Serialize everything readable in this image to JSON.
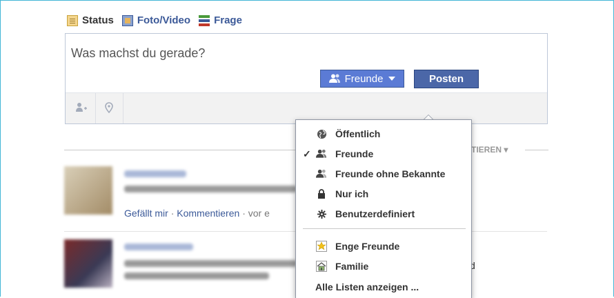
{
  "composer": {
    "tabs": [
      {
        "label": "Status"
      },
      {
        "label": "Foto/Video"
      },
      {
        "label": "Frage"
      }
    ],
    "placeholder": "Was machst du gerade?",
    "audience_label": "Freunde",
    "post_label": "Posten",
    "tag_icon": "tag-friends-icon",
    "location_icon": "location-pin-icon"
  },
  "feed": {
    "sort_label": "TIEREN",
    "story1": {
      "like_label": "Gefällt mir",
      "comment_label": "Kommentieren",
      "time_prefix": "· vor e"
    },
    "story2": {
      "trailing_char": "d"
    }
  },
  "audience_menu": {
    "items": [
      {
        "label": "Öffentlich",
        "icon": "globe-icon",
        "checked": false
      },
      {
        "label": "Freunde",
        "icon": "friends-icon",
        "checked": true
      },
      {
        "label": "Freunde ohne Bekannte",
        "icon": "friends-except-icon",
        "checked": false
      },
      {
        "label": "Nur ich",
        "icon": "lock-icon",
        "checked": false
      },
      {
        "label": "Benutzerdefiniert",
        "icon": "gear-icon",
        "checked": false
      }
    ],
    "lists": [
      {
        "label": "Enge Freunde",
        "icon": "star-icon"
      },
      {
        "label": "Familie",
        "icon": "house-icon"
      }
    ],
    "all_lists_label": "Alle Listen anzeigen ...",
    "check_glyph": "✓"
  },
  "colors": {
    "accent": "#3b5998",
    "button_blue": "#5b7bd5",
    "frame_border": "#41b6d6"
  }
}
